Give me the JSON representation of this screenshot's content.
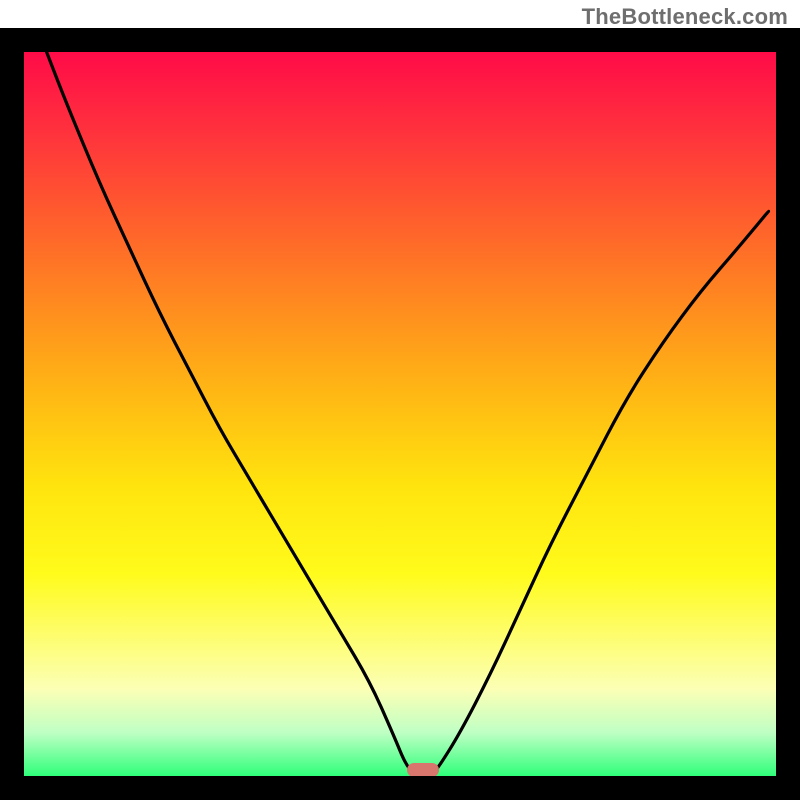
{
  "branding": {
    "watermark": "TheBottleneck.com"
  },
  "colors": {
    "border": "#000000",
    "curve": "#000000",
    "marker": "#d8766d",
    "gradient_top": "#ff0b48",
    "gradient_bottom": "#2fff7a"
  },
  "chart_data": {
    "type": "line",
    "title": "",
    "xlabel": "",
    "ylabel": "",
    "xlim": [
      0,
      100
    ],
    "ylim": [
      0,
      100
    ],
    "grid": false,
    "legend": false,
    "note": "Axes have no tick labels in the source image; x/y are normalized 0–100. y=0 is the bottom (green) edge, y=100 is the top (red) edge. Values are visual estimates from the plotted curve.",
    "series": [
      {
        "name": "bottleneck-curve",
        "x": [
          3,
          6,
          10,
          14,
          18,
          22,
          26,
          30,
          34,
          38,
          42,
          46,
          49,
          51,
          52.5,
          54,
          55,
          58,
          62,
          66,
          70,
          75,
          80,
          85,
          90,
          95,
          99
        ],
        "y": [
          100,
          92,
          82,
          73,
          64,
          56,
          48,
          41,
          34,
          27,
          20,
          13,
          6,
          1,
          0,
          0,
          1,
          6,
          14,
          23,
          32,
          42,
          52,
          60,
          67,
          73,
          78
        ]
      }
    ],
    "marker": {
      "name": "optimal-point",
      "x": 53,
      "y": 0,
      "shape": "pill"
    },
    "background_gradient": {
      "direction": "vertical",
      "stops": [
        {
          "pos": 0.0,
          "color": "#ff0b48"
        },
        {
          "pos": 0.22,
          "color": "#ff5a2e"
        },
        {
          "pos": 0.47,
          "color": "#ffb714"
        },
        {
          "pos": 0.72,
          "color": "#fffb1b"
        },
        {
          "pos": 0.94,
          "color": "#bfffc4"
        },
        {
          "pos": 1.0,
          "color": "#2fff7a"
        }
      ]
    }
  }
}
